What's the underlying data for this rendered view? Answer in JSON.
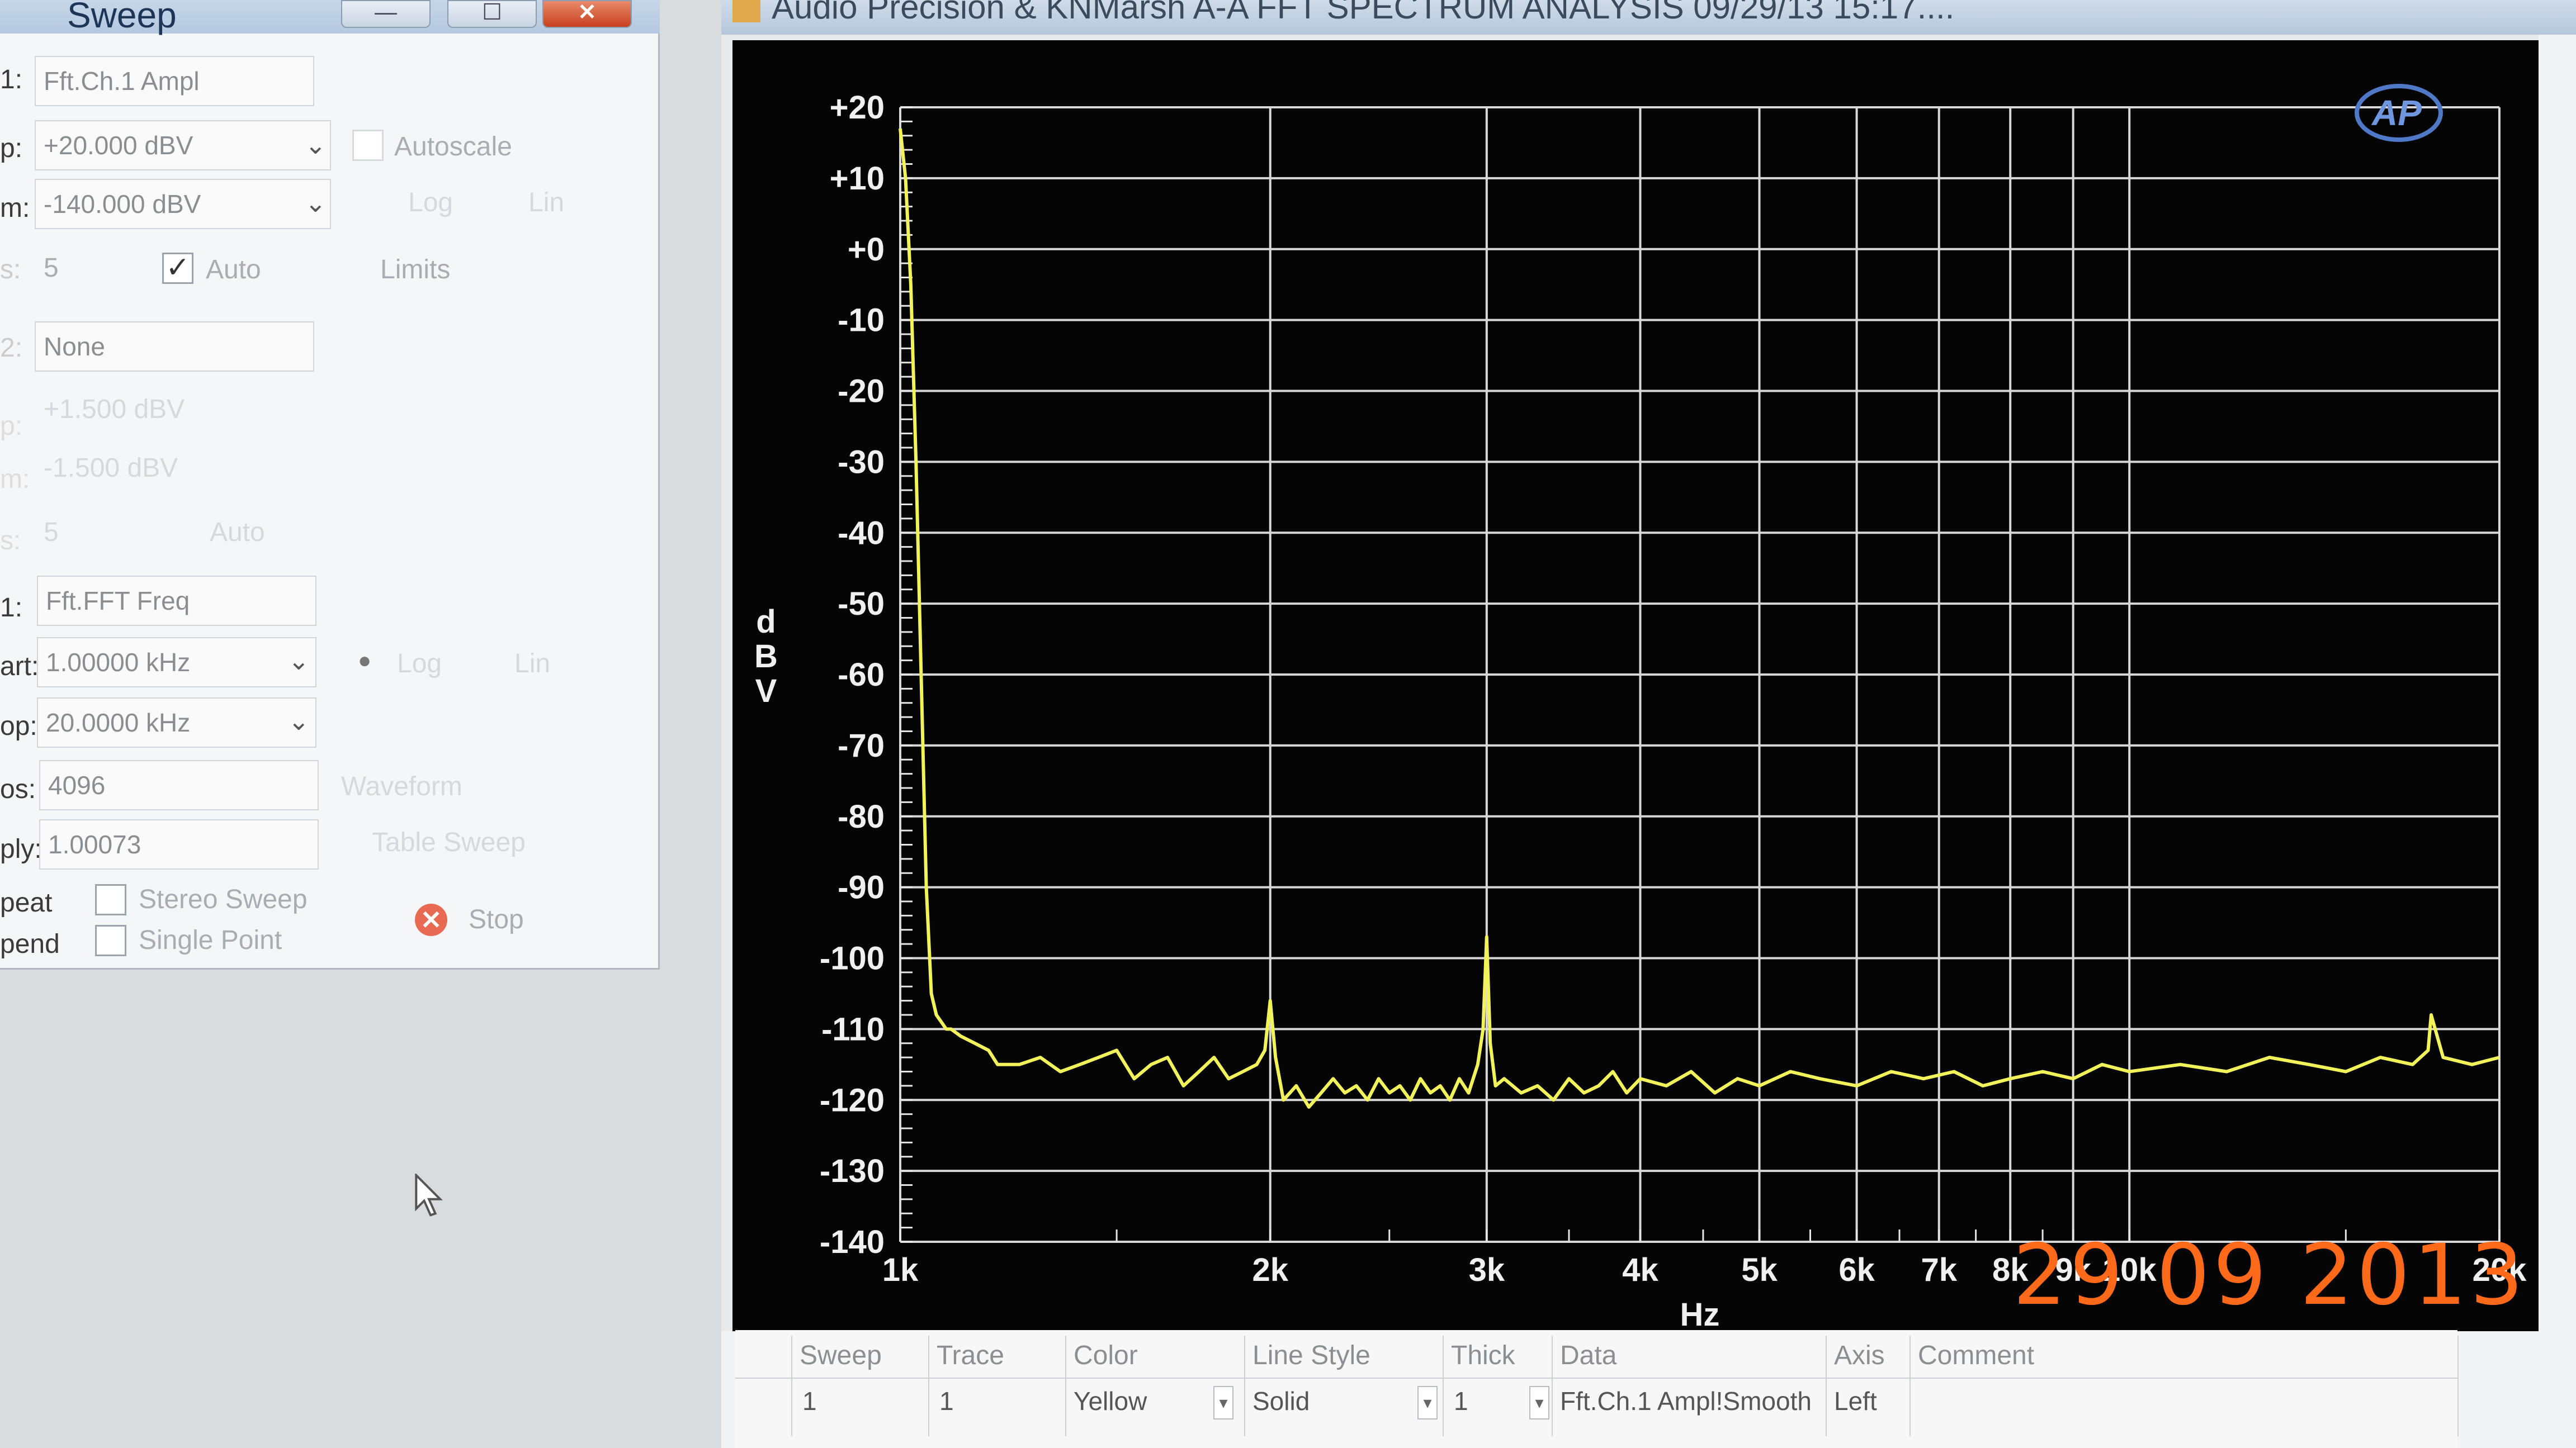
{
  "sweep_panel": {
    "title": "Sweep",
    "window_buttons": {
      "minimize": "—",
      "maximize": "☐",
      "close": "✕"
    },
    "rows": [
      {
        "label": "1:",
        "value": "Fft.Ch.1 Ampl"
      },
      {
        "label": "p:",
        "value": "+20.000 dBV",
        "checkbox_label": "Autoscale"
      },
      {
        "label": "m:",
        "value": "-140.000 dBV",
        "options": [
          "Log",
          "Lin"
        ]
      },
      {
        "label": "s:",
        "value": "5",
        "checkbox_label": "Auto",
        "extra": "Limits"
      },
      {
        "label": "2:",
        "value": "None"
      },
      {
        "label": "p:",
        "value": "+1.500  dBV"
      },
      {
        "label": "m:",
        "value": "-1.500  dBV"
      },
      {
        "label": "s:",
        "value": "5",
        "extra": "Auto"
      },
      {
        "label": "1:",
        "value": "Fft.FFT Freq"
      },
      {
        "label": "art:",
        "value": "1.00000 kHz",
        "options": [
          "Log",
          "Lin"
        ]
      },
      {
        "label": "op:",
        "value": "20.0000 kHz"
      },
      {
        "label": "os:",
        "value": "4096",
        "extra": "Waveform"
      },
      {
        "label": "ply:",
        "value": "1.00073",
        "extra": "Table Sweep"
      }
    ],
    "repeat_label": "peat",
    "append_label": "pend",
    "stereo_sweep_label": "Stereo Sweep",
    "single_point_label": "Single Point",
    "stop_label": "Stop"
  },
  "fft_window": {
    "title": "Audio Precision & KNMarsh    A-A FFT SPECTRUM ANALYSIS    09/29/13 15:17....",
    "logo": "AP",
    "date_stamp": "29  09  2013"
  },
  "chart_data": {
    "type": "line",
    "title": "",
    "xlabel": "Hz",
    "ylabel": "dBV",
    "xscale": "log",
    "xlim": [
      1000,
      20000
    ],
    "ylim": [
      -140,
      20
    ],
    "grid": true,
    "y_ticks": [
      "+20",
      "+10",
      "+0",
      "-10",
      "-20",
      "-30",
      "-40",
      "-50",
      "-60",
      "-70",
      "-80",
      "-90",
      "-100",
      "-110",
      "-120",
      "-130",
      "-140"
    ],
    "x_ticks": [
      {
        "value": 1000,
        "label": "1k"
      },
      {
        "value": 2000,
        "label": "2k"
      },
      {
        "value": 3000,
        "label": "3k"
      },
      {
        "value": 4000,
        "label": "4k"
      },
      {
        "value": 5000,
        "label": "5k"
      },
      {
        "value": 6000,
        "label": "6k"
      },
      {
        "value": 7000,
        "label": "7k"
      },
      {
        "value": 8000,
        "label": "8k"
      },
      {
        "value": 9000,
        "label": "9k"
      },
      {
        "value": 10000,
        "label": "10k"
      },
      {
        "value": 20000,
        "label": "20k"
      }
    ],
    "series": [
      {
        "color": "#f2f25a",
        "x": [
          1000,
          1010,
          1020,
          1030,
          1040,
          1050,
          1060,
          1070,
          1080,
          1090,
          1100,
          1120,
          1150,
          1180,
          1200,
          1250,
          1300,
          1350,
          1400,
          1450,
          1500,
          1550,
          1600,
          1650,
          1700,
          1750,
          1800,
          1850,
          1900,
          1950,
          1980,
          2000,
          2020,
          2050,
          2100,
          2150,
          2200,
          2250,
          2300,
          2350,
          2400,
          2450,
          2500,
          2550,
          2600,
          2650,
          2700,
          2750,
          2800,
          2850,
          2900,
          2950,
          2980,
          3000,
          3020,
          3050,
          3100,
          3200,
          3300,
          3400,
          3500,
          3600,
          3700,
          3800,
          3900,
          4000,
          4200,
          4400,
          4600,
          4800,
          5000,
          5300,
          5600,
          6000,
          6400,
          6800,
          7200,
          7600,
          8000,
          8500,
          9000,
          9500,
          10000,
          11000,
          12000,
          13000,
          14000,
          15000,
          16000,
          17000,
          17500,
          17600,
          18000,
          19000,
          20000
        ],
        "y": [
          17,
          10,
          -5,
          -30,
          -60,
          -90,
          -105,
          -108,
          -109,
          -110,
          -110,
          -111,
          -112,
          -113,
          -115,
          -115,
          -114,
          -116,
          -115,
          -114,
          -113,
          -117,
          -115,
          -114,
          -118,
          -116,
          -114,
          -117,
          -116,
          -115,
          -113,
          -106,
          -114,
          -120,
          -118,
          -121,
          -119,
          -117,
          -119,
          -118,
          -120,
          -117,
          -119,
          -118,
          -120,
          -117,
          -119,
          -118,
          -120,
          -117,
          -119,
          -115,
          -110,
          -97,
          -112,
          -118,
          -117,
          -119,
          -118,
          -120,
          -117,
          -119,
          -118,
          -116,
          -119,
          -117,
          -118,
          -116,
          -119,
          -117,
          -118,
          -116,
          -117,
          -118,
          -116,
          -117,
          -116,
          -118,
          -117,
          -116,
          -117,
          -115,
          -116,
          -115,
          -116,
          -114,
          -115,
          -116,
          -114,
          -115,
          -113,
          -108,
          -114,
          -115,
          -114
        ]
      }
    ]
  },
  "trace_table": {
    "headers": [
      "Sweep",
      "Trace",
      "Color",
      "Line Style",
      "Thick",
      "Data",
      "Axis",
      "Comment"
    ],
    "row": [
      "1",
      "1",
      "Yellow",
      "Solid",
      "1",
      "Fft.Ch.1 Ampl!Smooth",
      "Left",
      ""
    ]
  }
}
